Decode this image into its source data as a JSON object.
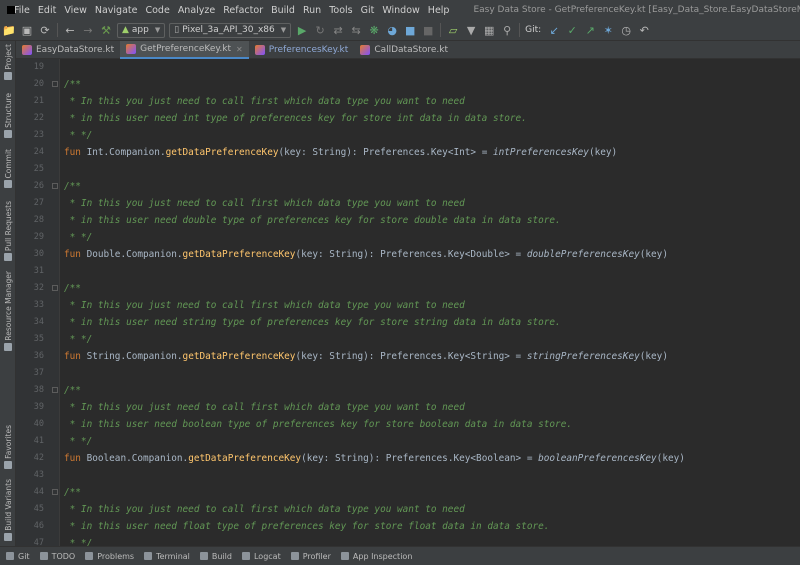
{
  "menubar": {
    "items": [
      "File",
      "Edit",
      "View",
      "Navigate",
      "Code",
      "Analyze",
      "Refactor",
      "Build",
      "Run",
      "Tools",
      "Git",
      "Window",
      "Help"
    ],
    "window_title": "Easy Data Store - GetPreferenceKey.kt [Easy_Data_Store.EasyDataStoreMethods]"
  },
  "toolbar": {
    "run_config": "app",
    "device": "Pixel_3a_API_30_x86",
    "git_label": "Git:"
  },
  "side_tabs": [
    "Project",
    "Structure",
    "Commit",
    "Pull Requests",
    "Resource Manager",
    "Favorites",
    "Build Variants"
  ],
  "tabs": [
    {
      "label": "EasyDataStore.kt",
      "active": false
    },
    {
      "label": "GetPreferenceKey.kt",
      "active": true
    },
    {
      "label": "PreferencesKey.kt",
      "active": false
    },
    {
      "label": "CallDataStore.kt",
      "active": false
    }
  ],
  "editor": {
    "line_numbers": [
      "19",
      "20",
      "21",
      "22",
      "23",
      "24",
      "25",
      "26",
      "27",
      "28",
      "29",
      "30",
      "31",
      "32",
      "33",
      "34",
      "35",
      "36",
      "37",
      "38",
      "39",
      "40",
      "41",
      "42",
      "43",
      "44",
      "45",
      "46",
      "47"
    ],
    "lines": {
      "l19": "",
      "l20": "/**",
      "l21": " * In this you just need to call first which data type you want to need",
      "l22": " * in this user need int type of preferences key for store int data in data store.",
      "l23": " * */",
      "l24": {
        "kw": "fun",
        "recv": " Int.Companion.",
        "fn": "getDataPreferenceKey",
        "sig": "(key: String): Preferences.Key<Int> = ",
        "call": "intPreferencesKey",
        "args": "(key)"
      },
      "l25": "",
      "l26": "/**",
      "l27": " * In this you just need to call first which data type you want to need",
      "l28": " * in this user need double type of preferences key for store double data in data store.",
      "l29": " * */",
      "l30": {
        "kw": "fun",
        "recv": " Double.Companion.",
        "fn": "getDataPreferenceKey",
        "sig": "(key: String): Preferences.Key<Double> = ",
        "call": "doublePreferencesKey",
        "args": "(key)"
      },
      "l31": "",
      "l32": "/**",
      "l33": " * In this you just need to call first which data type you want to need",
      "l34": " * in this user need string type of preferences key for store string data in data store.",
      "l35": " * */",
      "l36": {
        "kw": "fun",
        "recv": " String.Companion.",
        "fn": "getDataPreferenceKey",
        "sig": "(key: String): Preferences.Key<String> = ",
        "call": "stringPreferencesKey",
        "args": "(key)"
      },
      "l37": "",
      "l38": "/**",
      "l39": " * In this you just need to call first which data type you want to need",
      "l40": " * in this user need boolean type of preferences key for store boolean data in data store.",
      "l41": " * */",
      "l42": {
        "kw": "fun",
        "recv": " Boolean.Companion.",
        "fn": "getDataPreferenceKey",
        "sig": "(key: String): Preferences.Key<Boolean> = ",
        "call": "booleanPreferencesKey",
        "args": "(key)"
      },
      "l43": "",
      "l44": "/**",
      "l45": " * In this you just need to call first which data type you want to need",
      "l46": " * in this user need float type of preferences key for store float data in data store.",
      "l47": " * */"
    }
  },
  "bottombar": {
    "items": [
      "Git",
      "TODO",
      "Problems",
      "Terminal",
      "Build",
      "Logcat",
      "Profiler",
      "App Inspection"
    ]
  },
  "colors": {
    "editor_bg": "#2b2b2b",
    "panel_bg": "#3c3f41",
    "comment": "#629755",
    "keyword": "#cc7832",
    "function": "#ffc66d",
    "text": "#a9b7c6",
    "accent": "#4a88c7"
  }
}
